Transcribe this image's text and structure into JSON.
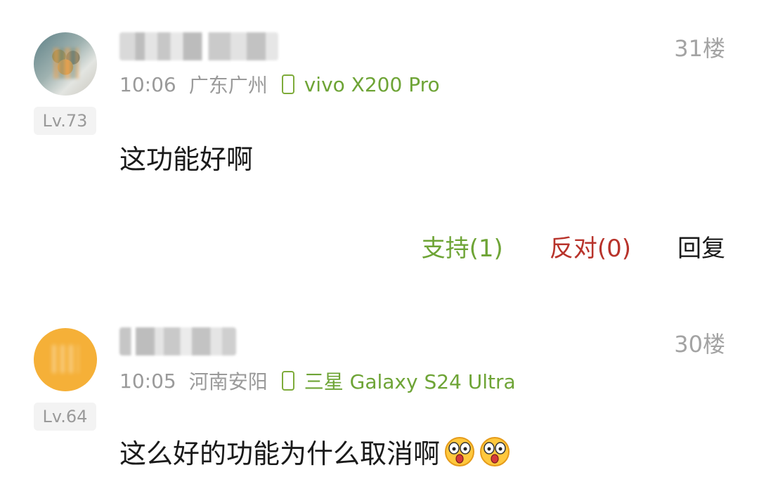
{
  "comments": [
    {
      "floor": "31楼",
      "level": "Lv.73",
      "time": "10:06",
      "location": "广东广州",
      "device": "vivo X200 Pro",
      "content": "这功能好啊",
      "actions": {
        "support": "支持(1)",
        "oppose": "反对(0)",
        "reply": "回复"
      }
    },
    {
      "floor": "30楼",
      "level": "Lv.64",
      "time": "10:05",
      "location": "河南安阳",
      "device": "三星 Galaxy S24 Ultra",
      "content": "这么好的功能为什么取消啊",
      "emoji": [
        "shocked-face-emoji",
        "shocked-face-emoji"
      ]
    }
  ],
  "colors": {
    "device_green": "#6ea436",
    "oppose_red": "#b8332b",
    "meta_gray": "#9a9a9a"
  }
}
